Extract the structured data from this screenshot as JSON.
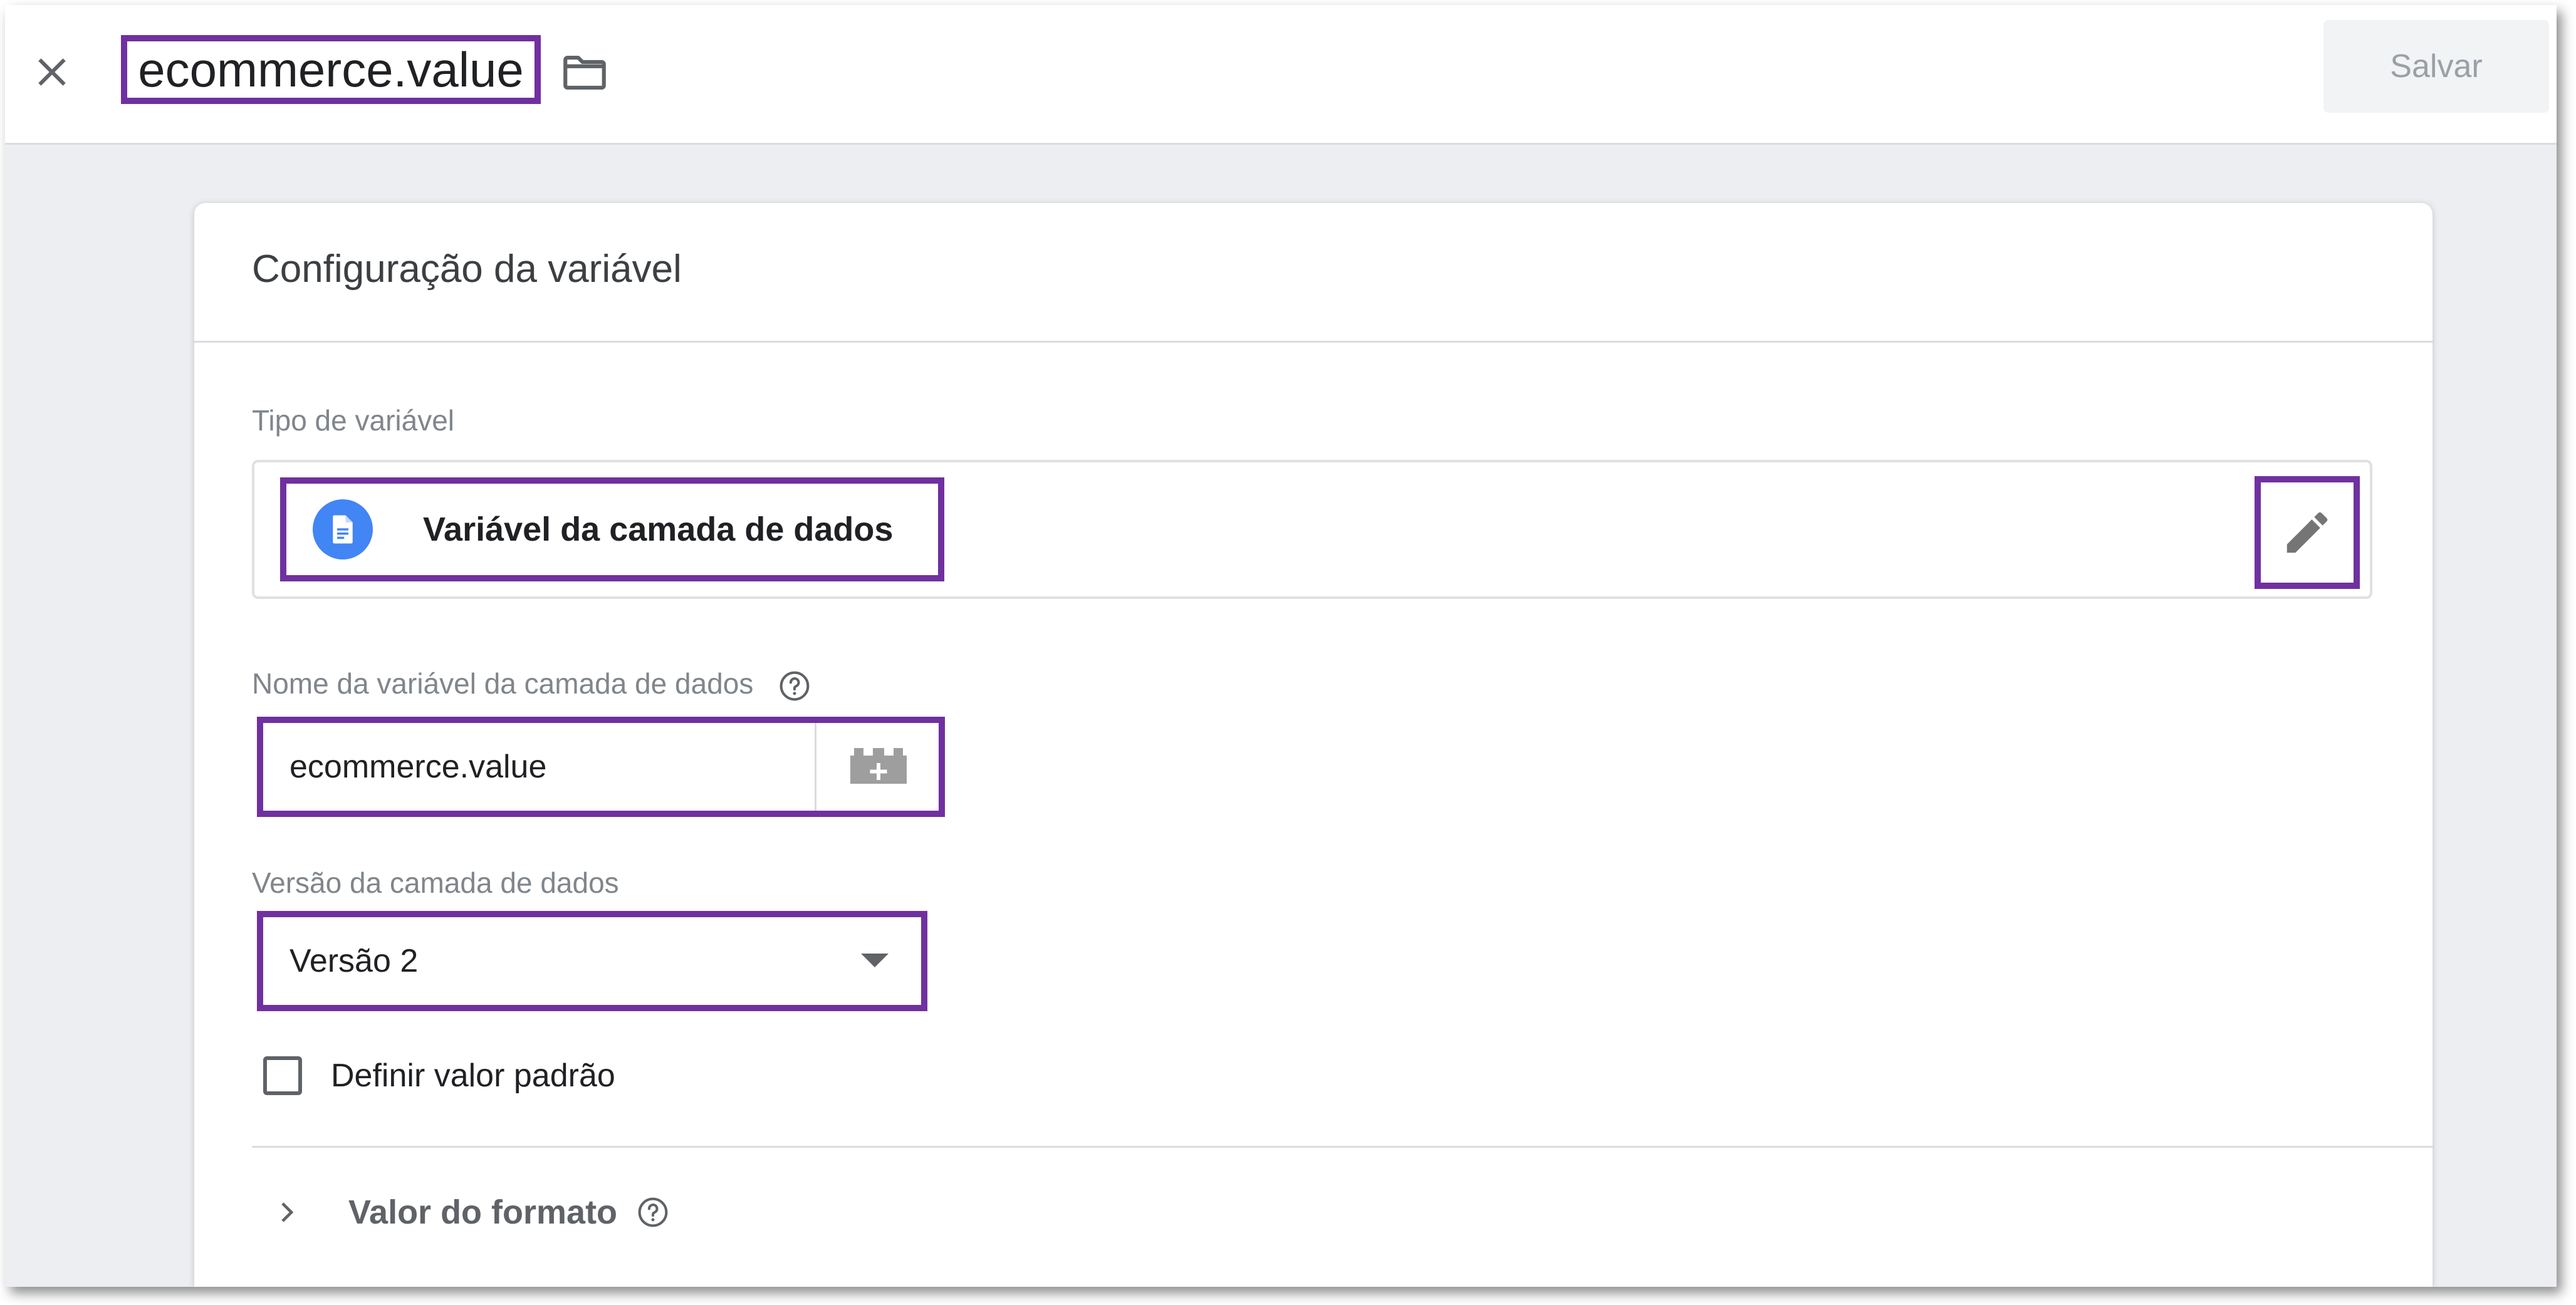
{
  "header": {
    "variable_name": "ecommerce.value",
    "save_label": "Salvar"
  },
  "card": {
    "title": "Configuração da variável",
    "variable_type_label": "Tipo de variável",
    "variable_type_name": "Variável da camada de dados",
    "datalayer_name_label": "Nome da variável da camada de dados",
    "datalayer_name_value": "ecommerce.value",
    "datalayer_version_label": "Versão da camada de dados",
    "datalayer_version_value": "Versão 2",
    "default_value_label": "Definir valor padrão",
    "default_value_checked": false,
    "format_value_label": "Valor do formato"
  },
  "icons": [
    "close-icon",
    "folder-icon",
    "document-icon",
    "pencil-icon",
    "help-icon",
    "variable-picker-icon",
    "chevron-right-icon",
    "dropdown-caret-icon"
  ],
  "colors": {
    "highlight": "#7030a0",
    "type_icon_bg": "#4285f4",
    "page_bg": "#eceef1"
  }
}
